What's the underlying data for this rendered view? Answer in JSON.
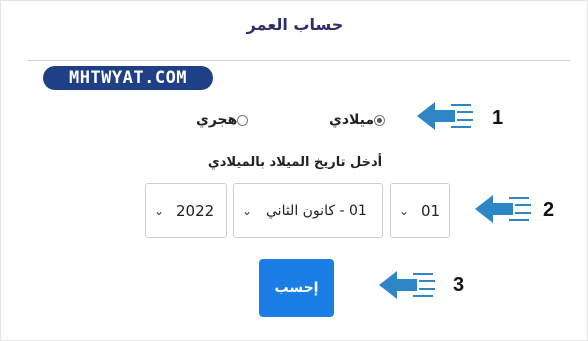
{
  "title": "حساب العمر",
  "logo_text": "MHTWYAT.COM",
  "calendar_options": [
    {
      "label": "ميلادي",
      "checked": true
    },
    {
      "label": "هجري",
      "checked": false
    }
  ],
  "prompt": "أدخل تاريخ الميلاد بالميلادي",
  "day_select": {
    "value": "01"
  },
  "month_select": {
    "value": "01 - كانون الثاني"
  },
  "year_select": {
    "value": "2022"
  },
  "calculate_label": "إحسب",
  "steps": [
    "1",
    "2",
    "3"
  ],
  "colors": {
    "accent": "#1a7ee6",
    "arrow": "#2f86c6",
    "logo": "#1f3f86",
    "title": "#2f2e6e"
  }
}
